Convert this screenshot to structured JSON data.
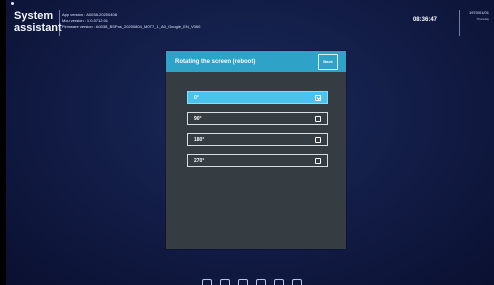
{
  "app": {
    "title": "System\nassistant",
    "app_version": "App version : A0038-20200408",
    "mcu_version": "Mcu version : 1.0.0712.01",
    "firmware_version": "Firmware version : A0038_BSPos_20200804_M0T7_1_A0_Google_EN_V060"
  },
  "status": {
    "time": "08:36:47",
    "date": "1970/01/01",
    "weekday": "Thursday"
  },
  "dialog": {
    "title": "Rotating the screen (reboot)",
    "back_label": "Back",
    "options": [
      {
        "label": "0°",
        "selected": true
      },
      {
        "label": "90°",
        "selected": false
      },
      {
        "label": "180°",
        "selected": false
      },
      {
        "label": "270°",
        "selected": false
      }
    ]
  },
  "icons": {
    "navbar": [
      "back-icon",
      "home-icon",
      "recent-apps-icon",
      "volume-down-icon",
      "volume-up-icon",
      "screenshot-icon"
    ]
  },
  "colors": {
    "accent": "#2ea2c7",
    "active_option": "#49c2ec",
    "dialog_bg": "#353c42",
    "screen_bg": "#111b44"
  }
}
